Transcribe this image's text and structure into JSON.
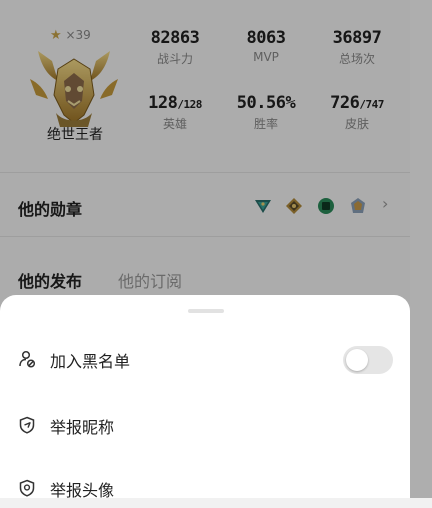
{
  "profile": {
    "rank_stars": "×39",
    "rank_title": "绝世王者",
    "stats": [
      {
        "value": "82863",
        "sub": "",
        "label": "战斗力"
      },
      {
        "value": "8063",
        "sub": "",
        "label": "MVP"
      },
      {
        "value": "36897",
        "sub": "",
        "label": "总场次"
      },
      {
        "value": "128",
        "sub": "/128",
        "label": "英雄"
      },
      {
        "value": "50.56%",
        "sub": "",
        "label": "胜率"
      },
      {
        "value": "726",
        "sub": "/747",
        "label": "皮肤"
      }
    ]
  },
  "medals": {
    "title": "他的勋章",
    "icons": [
      "triangle-medal-icon",
      "diamond-medal-icon",
      "round-medal-icon",
      "crest-medal-icon"
    ]
  },
  "tabs": {
    "active": "他的发布",
    "inactive": "他的订阅"
  },
  "sheet": {
    "options": [
      {
        "label": "加入黑名单",
        "icon": "user-block-icon",
        "toggle_on": false
      },
      {
        "label": "举报昵称",
        "icon": "report-shield-icon"
      },
      {
        "label": "举报头像",
        "icon": "report-avatar-shield-icon"
      }
    ]
  },
  "colors": {
    "overlay": "rgba(0,0,0,0.30)",
    "sheet_bg": "#ffffff",
    "toggle_off": "#e5e5e5",
    "medal_gold": "#c8a44a",
    "medal_green": "#2a8a5a"
  }
}
